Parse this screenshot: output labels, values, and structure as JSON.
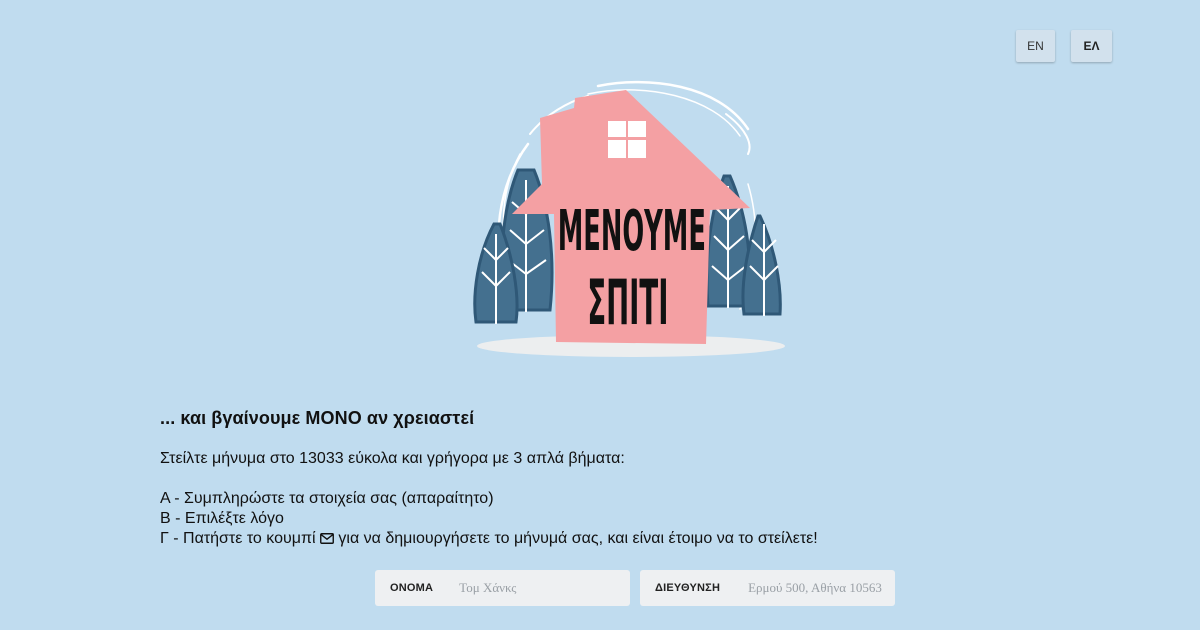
{
  "language_switch": {
    "en_label": "EN",
    "el_label": "ΕΛ",
    "active": "ΕΛ"
  },
  "logo": {
    "line1": "ΜΕΝΟΥΜΕ",
    "line2": "ΣΠΙΤΙ",
    "colors": {
      "house": "#f4a0a3",
      "trees": "#44708f",
      "window": "#ffffff"
    }
  },
  "main": {
    "heading": "... και βγαίνουμε ΜΟΝΟ αν χρειαστεί",
    "intro": "Στείλτε μήνυμα στο 13033 εύκολα και γρήγορα με 3 απλά βήματα:",
    "step_a": "Α - Συμπληρώστε τα στοιχεία σας (απαραίτητο)",
    "step_b": "Β - Επιλέξτε λόγο",
    "step_c_before": "Γ - Πατήστε το κουμπί ",
    "step_c_after": " για να δημιουργήσετε το μήνυμά σας, και είναι έτοιμο να το στείλετε!"
  },
  "form": {
    "name_label": "ΟΝΟΜΑ",
    "name_placeholder": "Τομ Χάνκς",
    "name_value": "",
    "address_label": "ΔΙΕΥΘΥΝΣΗ",
    "address_placeholder": "Ερμού 500, Αθήνα 10563",
    "address_value": ""
  },
  "colors": {
    "background": "#c0dcef",
    "field_bg": "#eef0f2",
    "lang_button_bg": "#d2e1ed"
  }
}
